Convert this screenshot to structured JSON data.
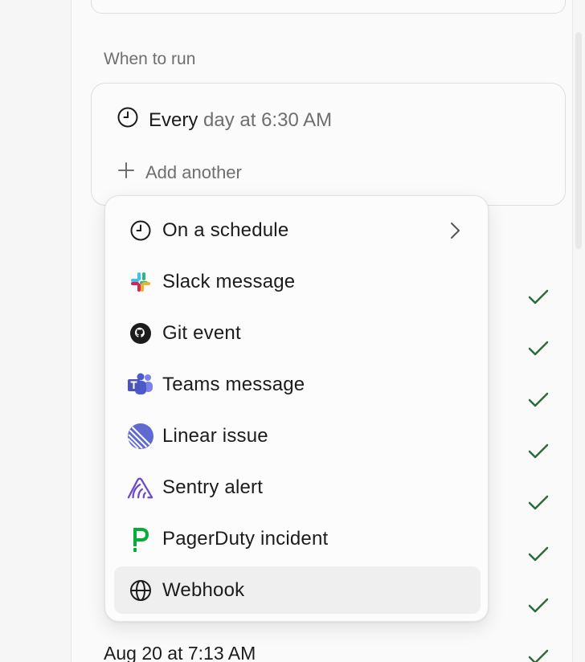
{
  "section": {
    "label": "When to run"
  },
  "schedule": {
    "every": "Every",
    "rest": "day at 6:30 AM"
  },
  "add_another": {
    "label": "Add another"
  },
  "menu": {
    "items": [
      {
        "label": "On a schedule",
        "icon": "clock-icon",
        "has_submenu": true
      },
      {
        "label": "Slack message",
        "icon": "slack-icon"
      },
      {
        "label": "Git event",
        "icon": "github-icon"
      },
      {
        "label": "Teams message",
        "icon": "teams-icon"
      },
      {
        "label": "Linear issue",
        "icon": "linear-icon"
      },
      {
        "label": "Sentry alert",
        "icon": "sentry-icon"
      },
      {
        "label": "PagerDuty incident",
        "icon": "pagerduty-icon"
      },
      {
        "label": "Webhook",
        "icon": "globe-icon",
        "highlighted": true
      }
    ]
  },
  "background_list": {
    "last_visible": "Aug 20 at 7:13 AM"
  },
  "colors": {
    "check": "#2f6b3a",
    "highlight": "#efefef",
    "muted_text": "#6f6f6f"
  }
}
